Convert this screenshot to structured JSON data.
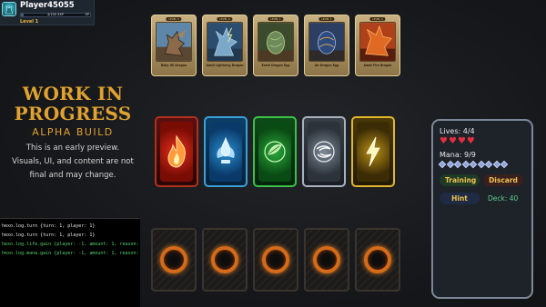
{
  "player": {
    "name": "Player45055",
    "xp_text": "4/100 XXP",
    "xp_level": "XP",
    "xp_fraction": 0.04,
    "level": "Level 1"
  },
  "wip": {
    "title_line1": "WORK IN",
    "title_line2": "PROGRESS",
    "subtitle": "ALPHA BUILD",
    "desc_line1": "This is an early preview.",
    "desc_line2": "Visuals, UI, and content are not",
    "desc_line3": "final and may change."
  },
  "hand": [
    {
      "badge": "LEVEL 3",
      "name": "Baby Oil Dragon",
      "art": "dragon-art"
    },
    {
      "badge": "LEVEL 4",
      "name": "Adult Lightning Dragon",
      "art": "dragon-art"
    },
    {
      "badge": "LEVEL 1",
      "name": "Earth Dragon Egg",
      "art": "egg-art"
    },
    {
      "badge": "LEVEL 1",
      "name": "Air Dragon Egg",
      "art": "egg-art"
    },
    {
      "badge": "LEVEL 4",
      "name": "Adult Fire Dragon",
      "art": "dragon-art"
    }
  ],
  "elements": [
    {
      "name": "fire",
      "icon": "fire-icon"
    },
    {
      "name": "water",
      "icon": "water-icon"
    },
    {
      "name": "nature",
      "icon": "nature-icon"
    },
    {
      "name": "air",
      "icon": "air-icon"
    },
    {
      "name": "lightning",
      "icon": "lightning-icon"
    }
  ],
  "log": [
    {
      "text": "hexo.log.turn {turn: 1, player: 1}",
      "color": "#e6e6e6"
    },
    {
      "text": "hexo.log.turn {turn: 1, player: 1}",
      "color": "#e6e6e6"
    },
    {
      "text": "hexo.log.life.gain {player: -1, amount: 1, reason: }",
      "color": "#57d16e"
    },
    {
      "text": "hexo.log.mana.gain {player: -1, amount: 1, reason: }",
      "color": "#57d16e"
    }
  ],
  "status": {
    "lives_label": "Lives: 4/4",
    "lives_count": 4,
    "mana_label": "Mana: 9/9",
    "mana_count": 9,
    "training_label": "Training",
    "discard_label": "Discard",
    "hint_label": "Hint",
    "deck_label": "Deck: 40"
  },
  "colors": {
    "accent": "#e0a230",
    "heart": "#e0303f",
    "log_green": "#57d16e"
  }
}
